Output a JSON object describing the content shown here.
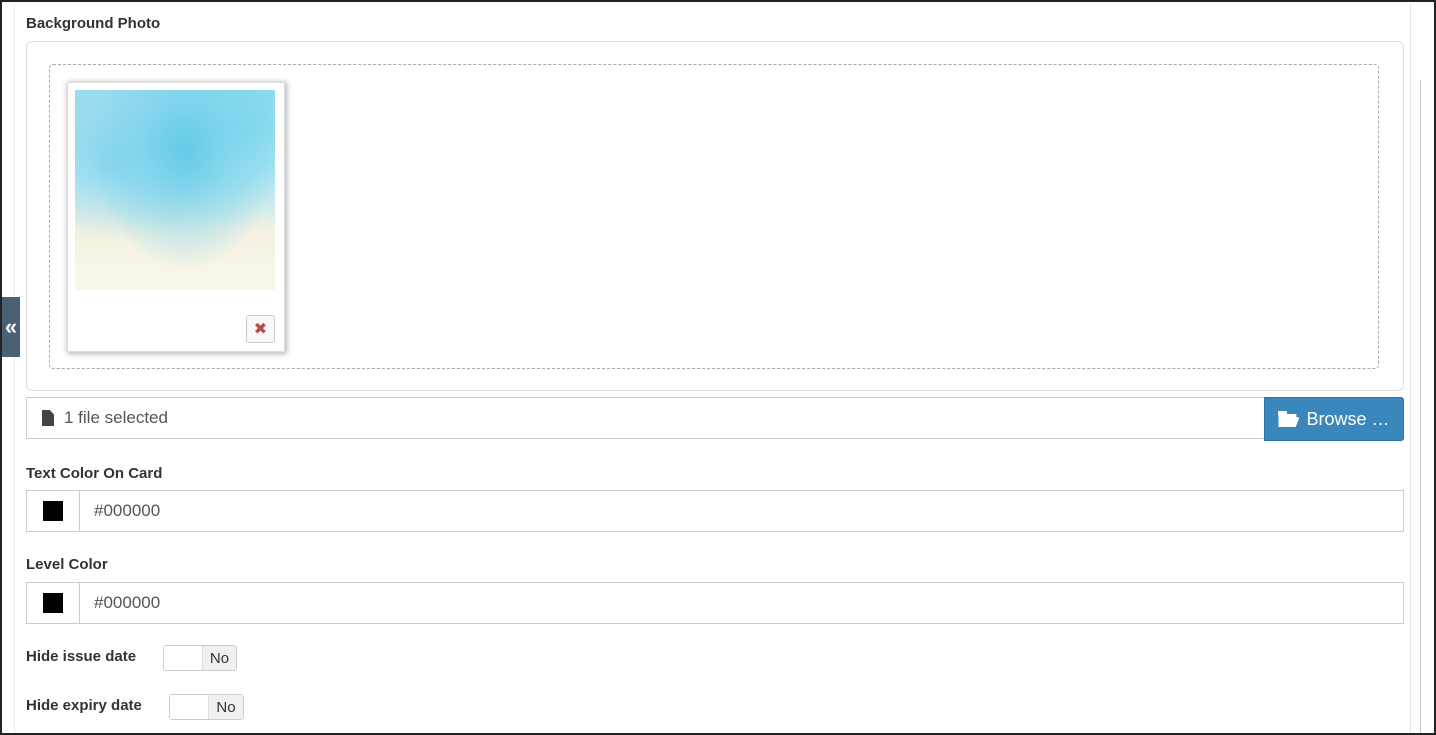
{
  "background_photo": {
    "label": "Background Photo",
    "file_caption": "1 file selected",
    "browse_label": "Browse …"
  },
  "text_color": {
    "label": "Text Color On Card",
    "value": "#000000",
    "swatch": "#000000"
  },
  "level_color": {
    "label": "Level Color",
    "value": "#000000",
    "swatch": "#000000"
  },
  "hide_issue_date": {
    "label": "Hide issue date",
    "state": "No"
  },
  "hide_expiry_date": {
    "label": "Hide expiry date",
    "state": "No"
  },
  "sidebar_toggle": {
    "glyph": "«"
  },
  "remove_glyph": "✖",
  "colors": {
    "browse_button": "#3a87bd",
    "remove_icon": "#b94a48",
    "sidebar_tab": "#4a6075"
  },
  "icons": {
    "file": "file-icon",
    "folder": "folder-open-icon",
    "remove": "close-icon",
    "collapse": "double-chevron-left-icon"
  }
}
